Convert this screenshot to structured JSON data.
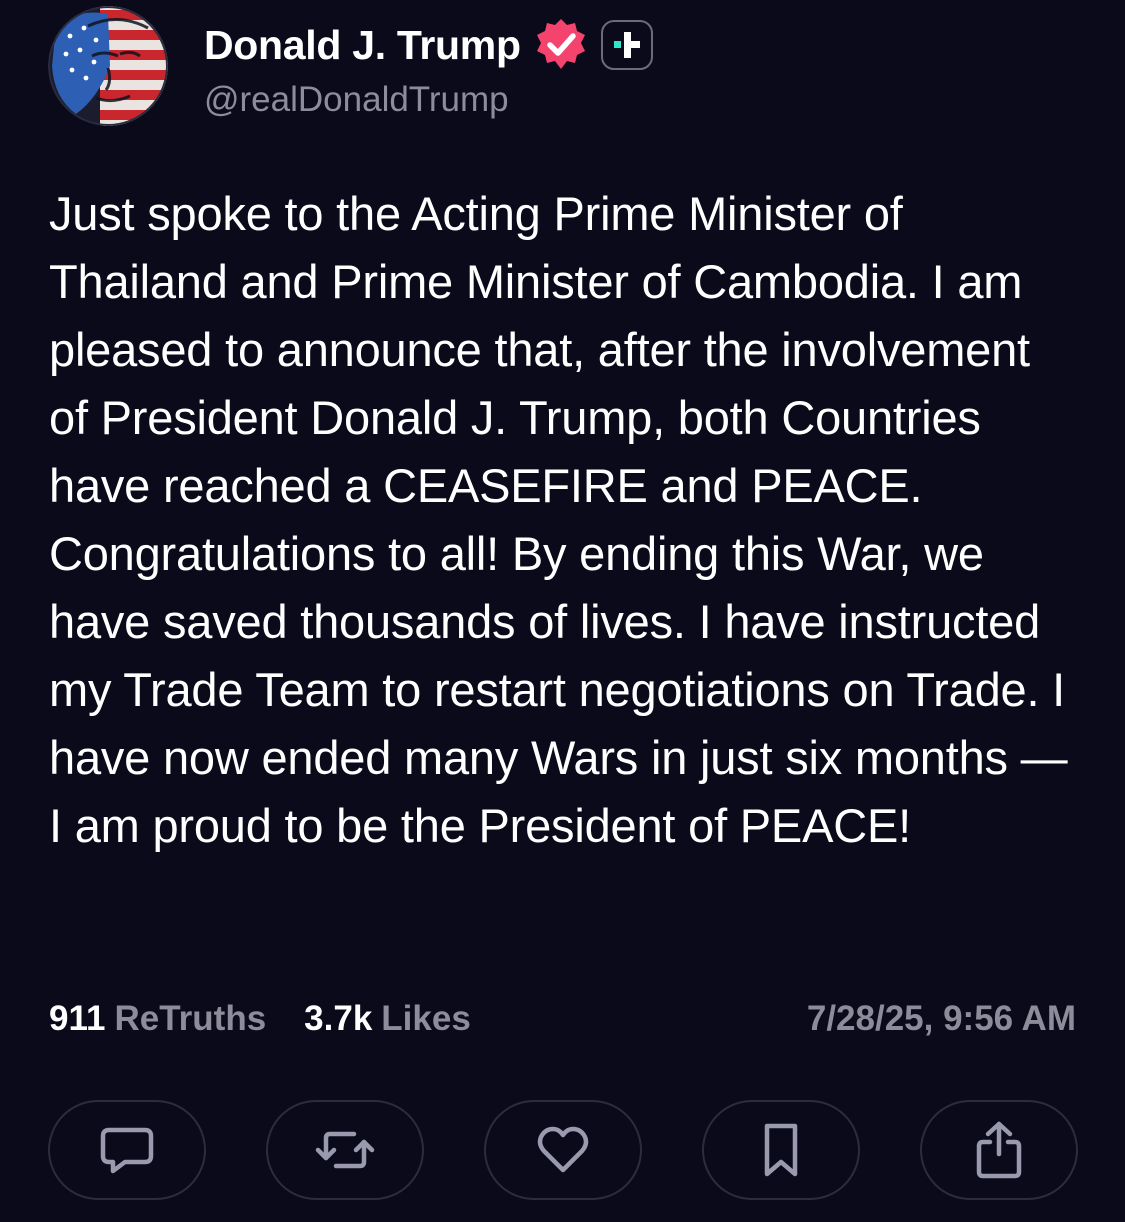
{
  "author": {
    "display_name": "Donald J. Trump",
    "handle": "@realDonaldTrump",
    "avatar_icon": "avatar-flag-portrait",
    "verified_icon": "verified-badge-icon",
    "verified_color": "#f4436c",
    "plus_badge_icon": "plus-icon",
    "plus_badge_accent": "#2ee6c9"
  },
  "post": {
    "text": "Just spoke to the Acting Prime Minister of Thailand and Prime Minister of Cambodia. I am pleased to announce that, after the involvement of President Donald J. Trump, both Countries have reached a CEASEFIRE and PEACE. Congratulations to all! By ending this War, we have saved thousands of lives. I have instructed my Trade Team to restart negotiations on Trade. I have now ended many Wars in just six months — I am proud to be the President of PEACE!"
  },
  "stats": {
    "retruths_count": "911",
    "retruths_label": "ReTruths",
    "likes_count": "3.7k",
    "likes_label": "Likes",
    "timestamp": "7/28/25, 9:56 AM"
  },
  "actions": [
    {
      "name": "reply",
      "icon": "comment-icon"
    },
    {
      "name": "retruth",
      "icon": "repost-icon"
    },
    {
      "name": "like",
      "icon": "heart-icon"
    },
    {
      "name": "bookmark",
      "icon": "bookmark-icon"
    },
    {
      "name": "share",
      "icon": "share-icon"
    }
  ],
  "colors": {
    "background": "#0a0a1a",
    "text_primary": "#ffffff",
    "text_secondary": "#8c8c9a",
    "button_border": "#2c2c40",
    "icon": "#9a9aae"
  }
}
